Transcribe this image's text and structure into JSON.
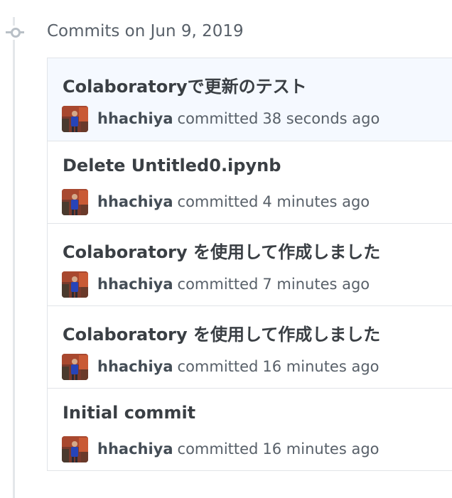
{
  "group": {
    "title": "Commits on Jun 9, 2019"
  },
  "commits": [
    {
      "title": "Colaboratoryで更新のテスト",
      "author": "hhachiya",
      "action": "committed",
      "time": "38 seconds ago"
    },
    {
      "title": "Delete Untitled0.ipynb",
      "author": "hhachiya",
      "action": "committed",
      "time": "4 minutes ago"
    },
    {
      "title": "Colaboratory を使用して作成しました",
      "author": "hhachiya",
      "action": "committed",
      "time": "7 minutes ago"
    },
    {
      "title": "Colaboratory を使用して作成しました",
      "author": "hhachiya",
      "action": "committed",
      "time": "16 minutes ago"
    },
    {
      "title": "Initial commit",
      "author": "hhachiya",
      "action": "committed",
      "time": "16 minutes ago"
    }
  ],
  "icons": {
    "timeline": "git-commit-icon",
    "avatar": "user-avatar-icon"
  },
  "colors": {
    "highlight_row": "#f5f9ff",
    "border": "#e1e4e8",
    "muted_text": "#586069"
  }
}
